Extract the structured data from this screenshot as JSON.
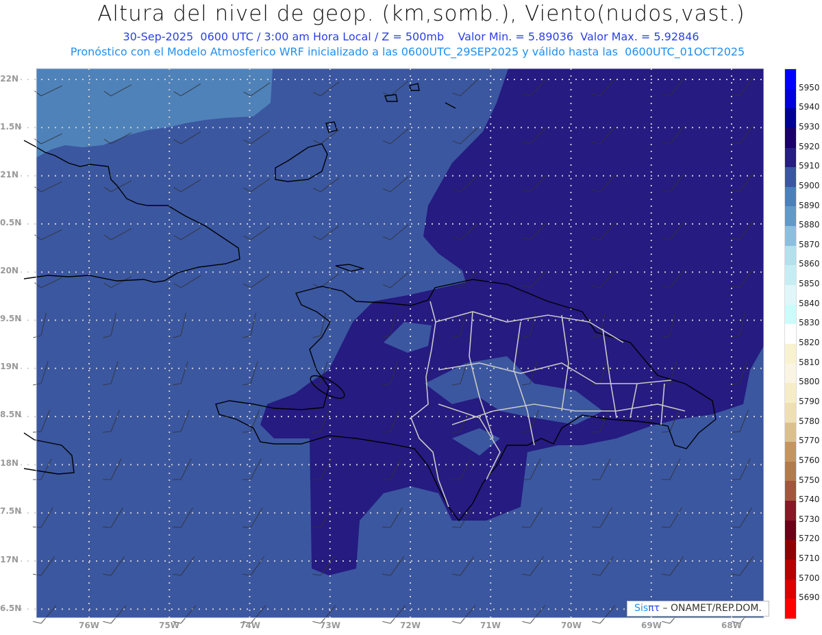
{
  "header": {
    "title": "Altura del nivel de geop. (km,somb.), Viento(nudos,vast.)",
    "subtitle_1": "30-Sep-2025  0600 UTC / 3:00 am Hora Local / Z = 500mb    Valor Min. = 5.89036  Valor Max. = 5.92846",
    "subtitle_2": "Pronóstico con el Modelo Atmosferico WRF inicializado a las 0600UTC_29SEP2025 y válido hasta las  0600UTC_01OCT2025"
  },
  "axes": {
    "y_labels": [
      "22N",
      "1.5N",
      "21N",
      "0.5N",
      "20N",
      "9.5N",
      "19N",
      "8.5N",
      "18N",
      "7.5N",
      "17N",
      "6.5N"
    ],
    "x_labels": [
      "76W",
      "75W",
      "74W",
      "73W",
      "72W",
      "71W",
      "70W",
      "69W",
      "68W"
    ]
  },
  "colorbar": {
    "labels": [
      "5950",
      "5940",
      "5930",
      "5920",
      "5910",
      "5900",
      "5890",
      "5880",
      "5870",
      "5860",
      "5850",
      "5840",
      "5830",
      "5820",
      "5810",
      "5800",
      "5790",
      "5780",
      "5770",
      "5760",
      "5750",
      "5740",
      "5730",
      "5720",
      "5710",
      "5700",
      "5690"
    ],
    "colors": [
      "#0000ff",
      "#0000dc",
      "#000096",
      "#1a0068",
      "#261e80",
      "#3b57a0",
      "#4b80bb",
      "#6199c8",
      "#8cbfdd",
      "#b3e0ec",
      "#c6edf4",
      "#e0f6f8",
      "#ccfbfb",
      "#ffffff",
      "#f8f2d0",
      "#faf5e3",
      "#f6edc8",
      "#eedfb5",
      "#dbc08f",
      "#c4955f",
      "#b27b4b",
      "#a1573c",
      "#861a27",
      "#6b0018",
      "#900000",
      "#b90000",
      "#dc0000",
      "#ff0000"
    ]
  },
  "map_colors": {
    "base": "#3b57a0",
    "light": "#4f82b9",
    "dark": "#251b80"
  },
  "credit": {
    "part1": "Sis",
    "part2": "πτ",
    "part3": "– ONAMET/REP.DOM."
  }
}
